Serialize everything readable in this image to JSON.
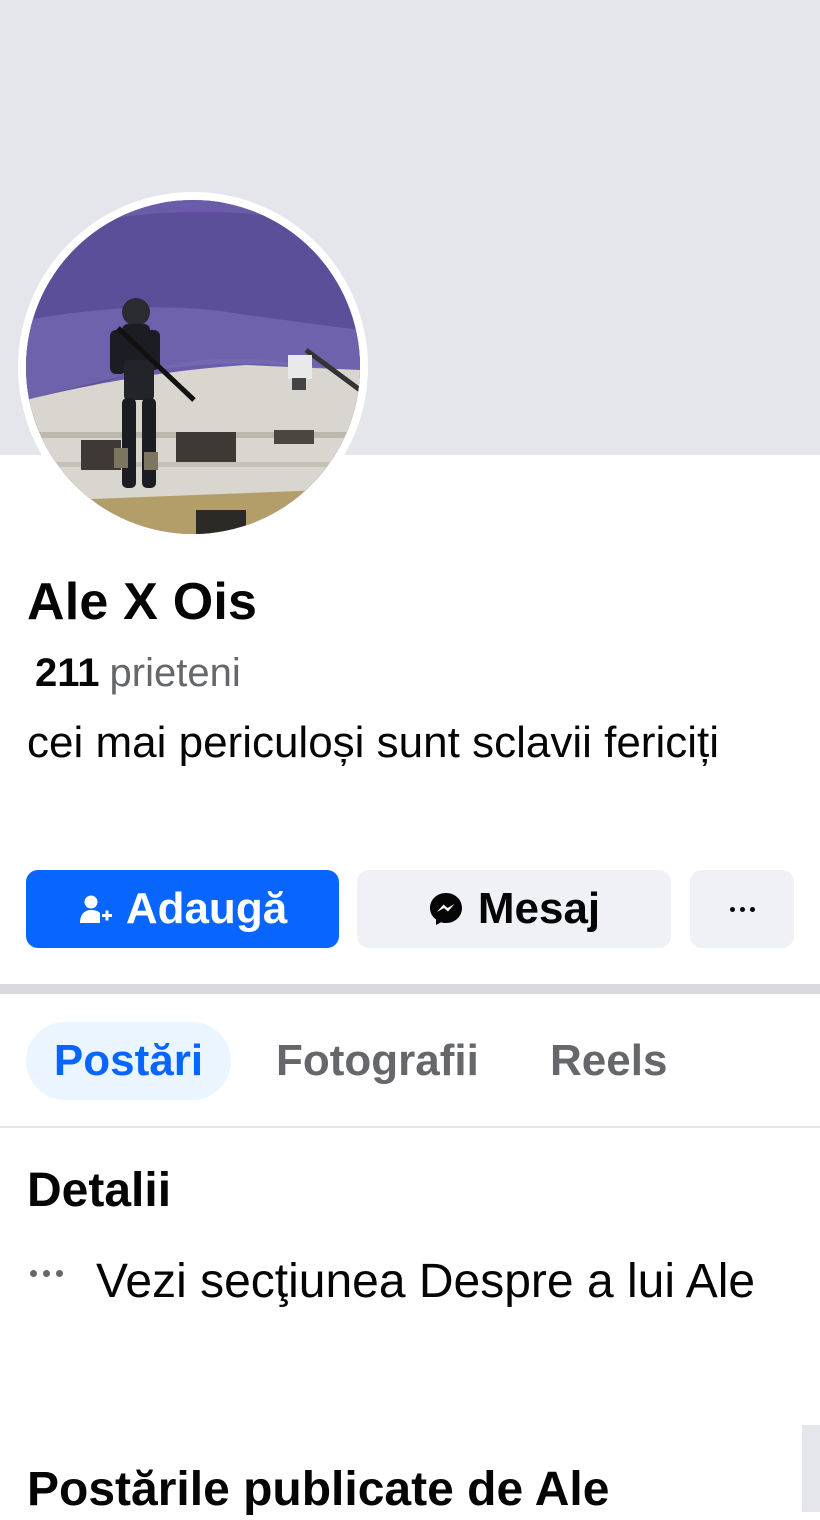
{
  "profile": {
    "name": "Ale X Ois",
    "friends_count": "211",
    "friends_label": "prieteni",
    "bio": "cei mai periculoși sunt sclavii fericiți"
  },
  "actions": {
    "add_label": "Adaugă",
    "message_label": "Mesaj"
  },
  "tabs": [
    {
      "label": "Postări",
      "active": true
    },
    {
      "label": "Fotografii",
      "active": false
    },
    {
      "label": "Reels",
      "active": false
    }
  ],
  "details": {
    "title": "Detalii",
    "see_about": "Vezi secţiunea Despre a lui Ale"
  },
  "posts": {
    "title": "Postările publicate de Ale"
  },
  "colors": {
    "primary": "#0866ff",
    "secondary_button": "#f0f1f6",
    "cover": "#e4e6eb",
    "muted_text": "#65676b"
  },
  "icons": {
    "add": "add-friend-icon",
    "message": "messenger-icon",
    "more": "more-dots-icon",
    "details": "more-dots-icon"
  }
}
